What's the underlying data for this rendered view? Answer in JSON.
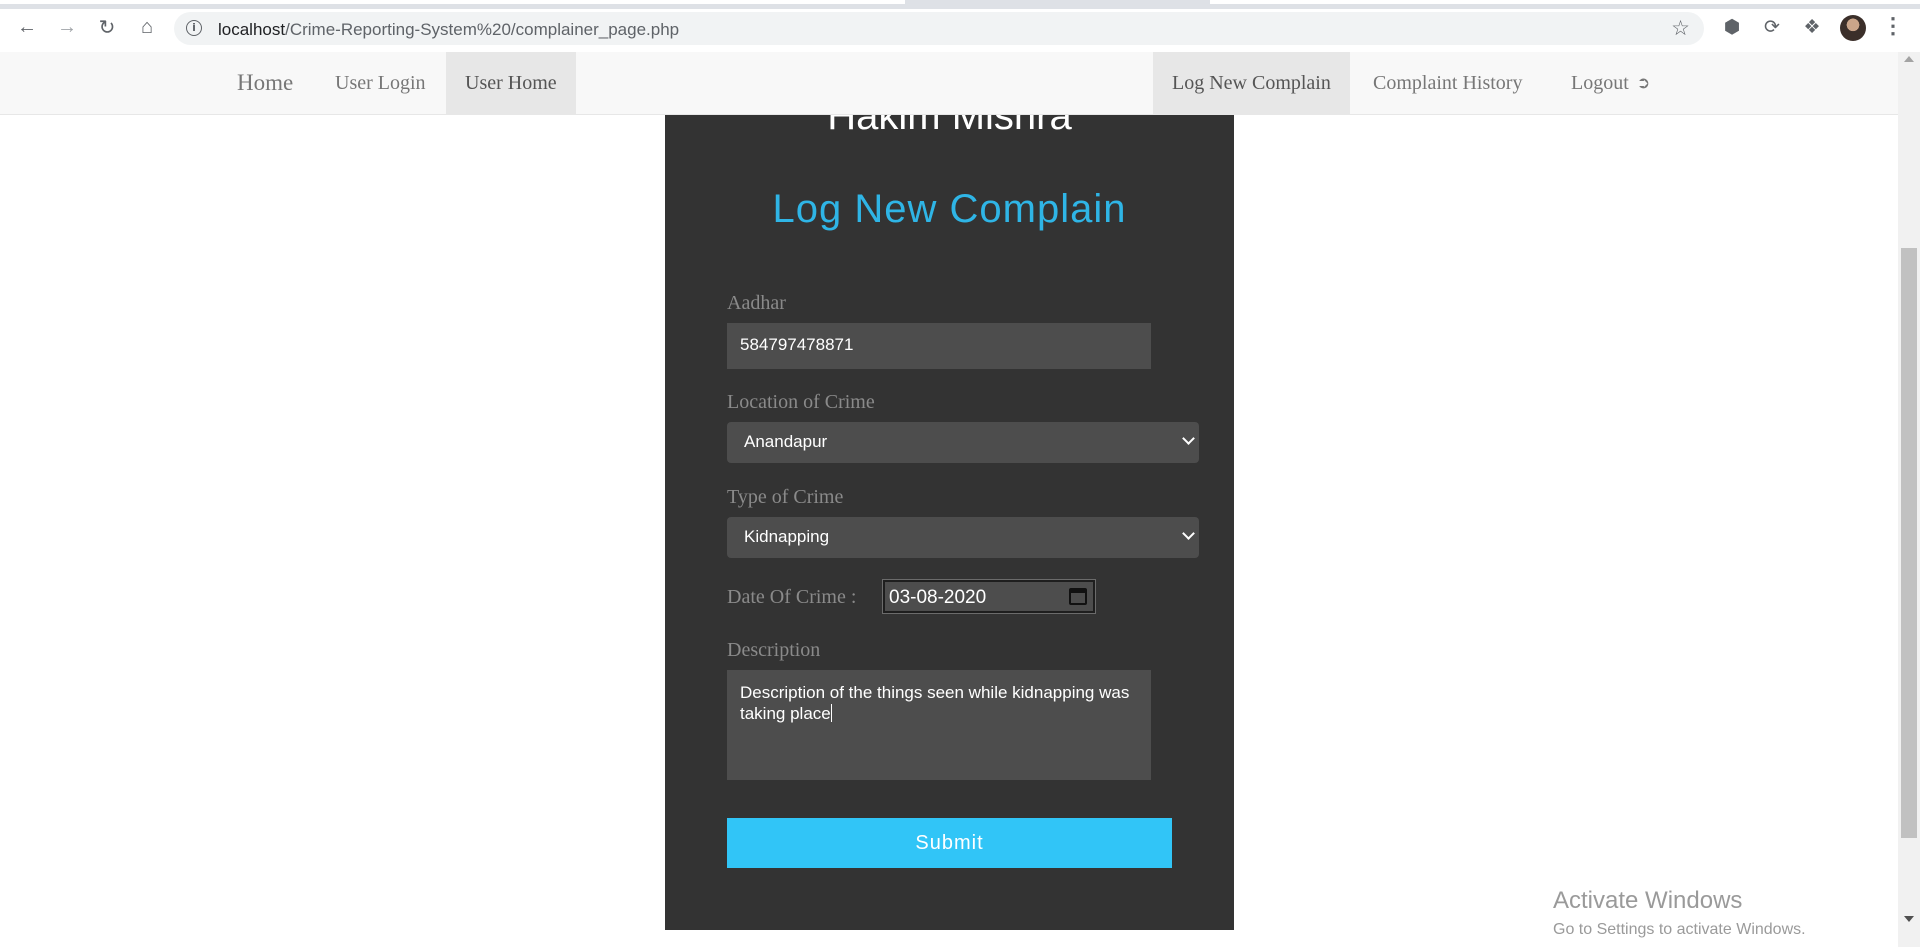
{
  "browser": {
    "url_host": "localhost",
    "url_path": "/Crime-Reporting-System%20/complainer_page.php",
    "icons": [
      "back-icon",
      "forward-icon",
      "reload-icon",
      "home-icon",
      "info-icon",
      "star-icon",
      "extension-cube-icon",
      "sync-icon",
      "puzzle-icon",
      "profile-avatar",
      "kebab-menu-icon"
    ]
  },
  "nav": {
    "left": [
      {
        "label": "Home"
      },
      {
        "label": "User Login"
      },
      {
        "label": "User Home"
      }
    ],
    "right": [
      {
        "label": "Log New Complain"
      },
      {
        "label": "Complaint History"
      },
      {
        "label": "Logout"
      }
    ]
  },
  "panel": {
    "cut_title": "Hakim Mishra",
    "title": "Log New Complain",
    "aadhar_label": "Aadhar",
    "aadhar_value": "584797478871",
    "location_label": "Location of Crime",
    "location_value": "Anandapur",
    "type_label": "Type of Crime",
    "type_value": "Kidnapping",
    "date_label": "Date Of Crime :",
    "date_value": "03-08-2020",
    "description_label": "Description",
    "description_value": "Description of the things seen while kidnapping was taking place",
    "submit_label": "Submit"
  },
  "watermark": {
    "title": "Activate Windows",
    "subtitle": "Go to Settings to activate Windows."
  },
  "colors": {
    "panel_bg": "#333333",
    "accent_title": "#2fb5e6",
    "submit_bg": "#31c5f7",
    "field_bg": "#4d4d4d",
    "nav_bg": "#f8f8f8",
    "nav_active_bg": "#e7e7e7"
  }
}
